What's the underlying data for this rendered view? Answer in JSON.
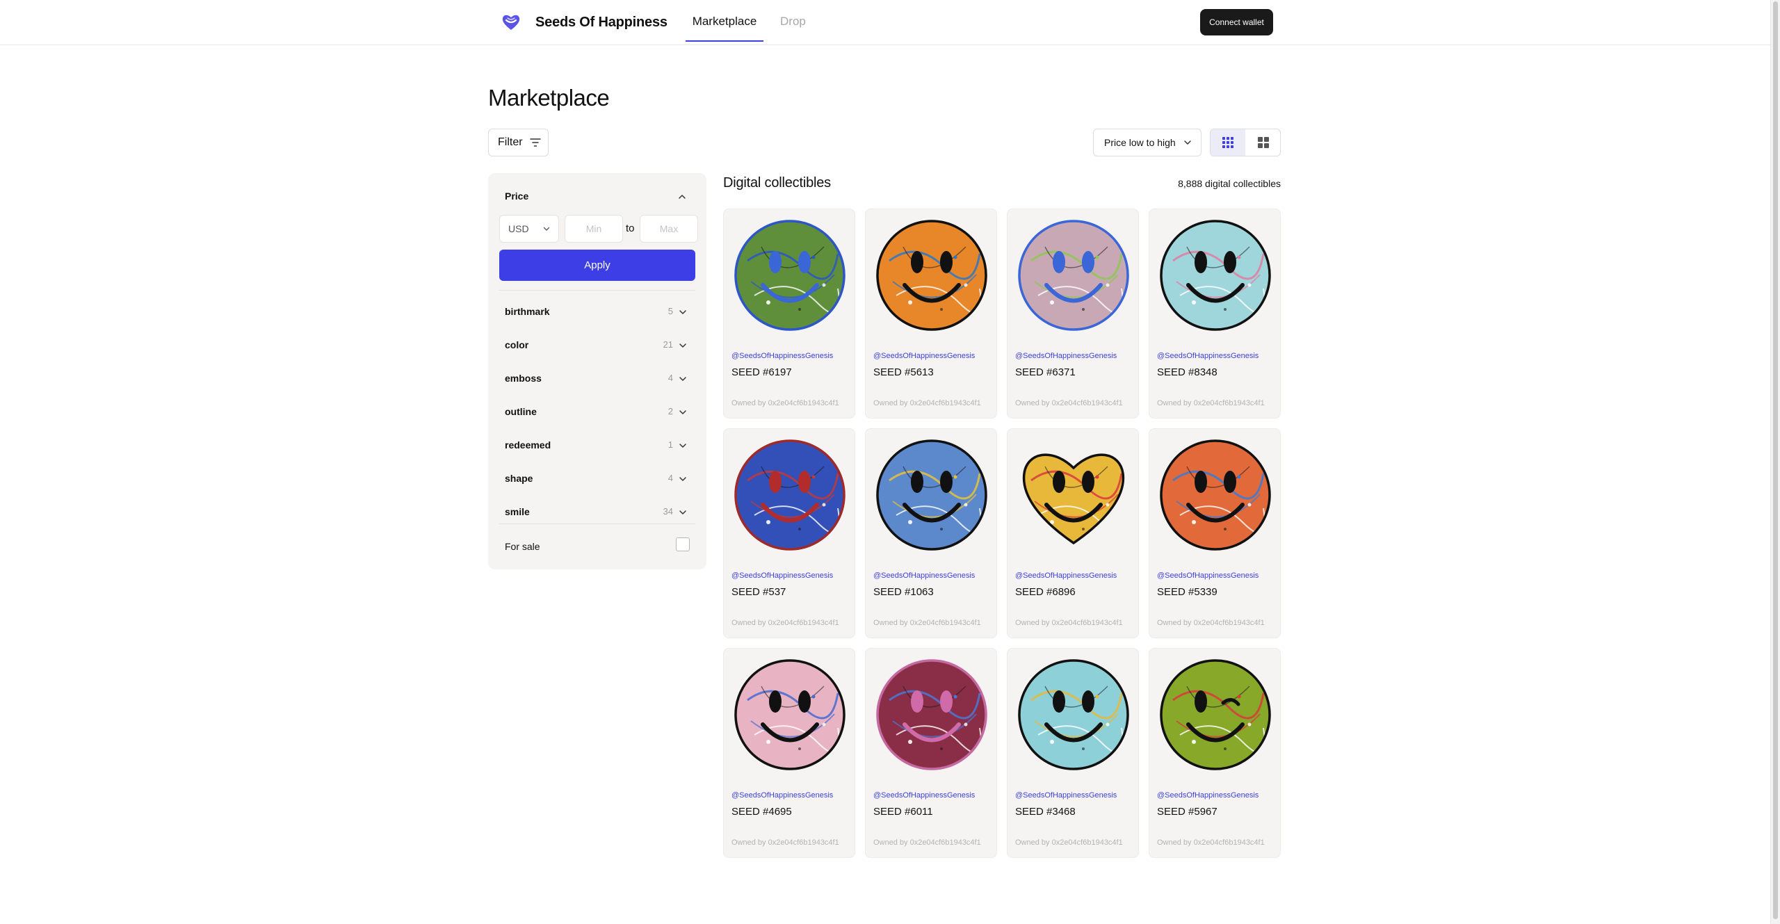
{
  "header": {
    "brand": "Seeds Of Happiness",
    "logo_icon": "heart-logo-icon",
    "nav": [
      {
        "label": "Marketplace",
        "active": true
      },
      {
        "label": "Drop",
        "active": false
      }
    ],
    "connect_wallet": "Connect wallet"
  },
  "page": {
    "title": "Marketplace"
  },
  "toolbar": {
    "filter_label": "Filter",
    "sort_label": "Price low to high",
    "view_modes": [
      "small-grid",
      "large-grid"
    ],
    "active_view": "small-grid"
  },
  "sidebar": {
    "price_label": "Price",
    "currency": "USD",
    "min_placeholder": "Min",
    "max_placeholder": "Max",
    "to_label": "to",
    "apply_label": "Apply",
    "attributes": [
      {
        "name": "birthmark",
        "count": "5"
      },
      {
        "name": "color",
        "count": "21"
      },
      {
        "name": "emboss",
        "count": "4"
      },
      {
        "name": "outline",
        "count": "2"
      },
      {
        "name": "redeemed",
        "count": "1"
      },
      {
        "name": "shape",
        "count": "4"
      },
      {
        "name": "smile",
        "count": "34"
      }
    ],
    "for_sale_label": "For sale",
    "for_sale_checked": false
  },
  "collection": {
    "title": "Digital collectibles",
    "count_label": "8,888 digital collectibles",
    "items": [
      {
        "creator": "@SeedsOfHappinessGenesis",
        "name": "SEED #6197",
        "owner": "Owned by 0x2e04cf6b1943c4f1",
        "bg": "#5f8f3a",
        "accent": "#2d56c8",
        "outline": "#2d56c8",
        "eyes": "#3a66d8",
        "shape": "circle"
      },
      {
        "creator": "@SeedsOfHappinessGenesis",
        "name": "SEED #5613",
        "owner": "Owned by 0x2e04cf6b1943c4f1",
        "bg": "#e8862a",
        "accent": "#2a78c8",
        "outline": "#111111",
        "eyes": "#111111",
        "shape": "circle"
      },
      {
        "creator": "@SeedsOfHappinessGenesis",
        "name": "SEED #6371",
        "owner": "Owned by 0x2e04cf6b1943c4f1",
        "bg": "#c8a8b4",
        "accent": "#8cc850",
        "outline": "#3a66d8",
        "eyes": "#3a66d8",
        "shape": "circle"
      },
      {
        "creator": "@SeedsOfHappinessGenesis",
        "name": "SEED #8348",
        "owner": "Owned by 0x2e04cf6b1943c4f1",
        "bg": "#9fd6dc",
        "accent": "#e27ca0",
        "outline": "#111111",
        "eyes": "#111111",
        "shape": "circle"
      },
      {
        "creator": "@SeedsOfHappinessGenesis",
        "name": "SEED #537",
        "owner": "Owned by 0x2e04cf6b1943c4f1",
        "bg": "#3350b8",
        "accent": "#c23838",
        "outline": "#9e2a2a",
        "eyes": "#b32c2c",
        "shape": "circle"
      },
      {
        "creator": "@SeedsOfHappinessGenesis",
        "name": "SEED #1063",
        "owner": "Owned by 0x2e04cf6b1943c4f1",
        "bg": "#5c88cc",
        "accent": "#e8c23a",
        "outline": "#111111",
        "eyes": "#111111",
        "shape": "circle"
      },
      {
        "creator": "@SeedsOfHappinessGenesis",
        "name": "SEED #6896",
        "owner": "Owned by 0x2e04cf6b1943c4f1",
        "bg": "#e8b83a",
        "accent": "#d83a3a",
        "outline": "#111111",
        "eyes": "#111111",
        "shape": "heart"
      },
      {
        "creator": "@SeedsOfHappinessGenesis",
        "name": "SEED #5339",
        "owner": "Owned by 0x2e04cf6b1943c4f1",
        "bg": "#e26a3a",
        "accent": "#3a7ad8",
        "outline": "#111111",
        "eyes": "#111111",
        "shape": "circle"
      },
      {
        "creator": "@SeedsOfHappinessGenesis",
        "name": "SEED #4695",
        "owner": "Owned by 0x2e04cf6b1943c4f1",
        "bg": "#e8b4c4",
        "accent": "#4a6ad0",
        "outline": "#111111",
        "eyes": "#111111",
        "shape": "circle"
      },
      {
        "creator": "@SeedsOfHappinessGenesis",
        "name": "SEED #6011",
        "owner": "Owned by 0x2e04cf6b1943c4f1",
        "bg": "#8a2e48",
        "accent": "#4a78d8",
        "outline": "#c46aa0",
        "eyes": "#d06aa8",
        "shape": "circle"
      },
      {
        "creator": "@SeedsOfHappinessGenesis",
        "name": "SEED #3468",
        "owner": "Owned by 0x2e04cf6b1943c4f1",
        "bg": "#8ed0d8",
        "accent": "#e8b83a",
        "outline": "#111111",
        "eyes": "#111111",
        "shape": "circle"
      },
      {
        "creator": "@SeedsOfHappinessGenesis",
        "name": "SEED #5967",
        "owner": "Owned by 0x2e04cf6b1943c4f1",
        "bg": "#88a82a",
        "accent": "#d83a3a",
        "outline": "#111111",
        "eyes": "#111111",
        "shape": "wink"
      }
    ]
  },
  "colors": {
    "accent": "#3d3ee6",
    "panel": "#f5f4f2",
    "dark_button": "#1a1a1a"
  }
}
